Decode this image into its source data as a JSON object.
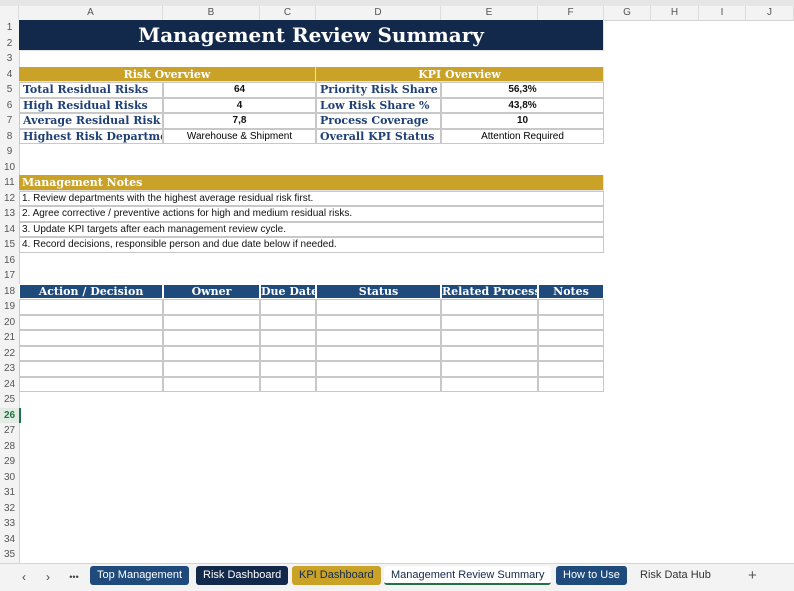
{
  "columns": [
    "A",
    "B",
    "C",
    "D",
    "E",
    "F",
    "G",
    "H",
    "I",
    "J"
  ],
  "rows": [
    "1",
    "2",
    "3",
    "4",
    "5",
    "6",
    "7",
    "8",
    "9",
    "10",
    "11",
    "12",
    "13",
    "14",
    "15",
    "16",
    "17",
    "18",
    "19",
    "20",
    "21",
    "22",
    "23",
    "24",
    "25",
    "26",
    "27",
    "28",
    "29",
    "30",
    "31",
    "32",
    "33",
    "34",
    "35"
  ],
  "title": "Management Review Summary",
  "risk_overview": {
    "header": "Risk Overview",
    "items": [
      {
        "label": "Total Residual Risks",
        "value": "64"
      },
      {
        "label": "High Residual Risks",
        "value": "4"
      },
      {
        "label": "Average Residual Risk",
        "value": "7,8"
      },
      {
        "label": "Highest Risk Department",
        "value": "Warehouse & Shipment"
      }
    ]
  },
  "kpi_overview": {
    "header": "KPI Overview",
    "items": [
      {
        "label": "Priority Risk Share %",
        "value": "56,3%"
      },
      {
        "label": "Low Risk Share %",
        "value": "43,8%"
      },
      {
        "label": "Process Coverage",
        "value": "10"
      },
      {
        "label": "Overall KPI Status",
        "value": "Attention Required"
      }
    ]
  },
  "notes": {
    "header": "Management Notes",
    "items": [
      "1. Review departments with the highest average residual risk first.",
      "2. Agree corrective / preventive actions for high and medium residual risks.",
      "3. Update KPI targets after each management review cycle.",
      "4. Record decisions, responsible person and due date below if needed."
    ]
  },
  "action_table": {
    "headers": [
      "Action / Decision",
      "Owner",
      "Due Date",
      "Status",
      "Related Process",
      "Notes"
    ]
  },
  "tabs": {
    "nav_prev": "‹",
    "nav_next": "›",
    "more": "•••",
    "items": [
      "Top Management",
      "Risk Dashboard",
      "KPI Dashboard",
      "Management Review Summary",
      "How to Use",
      "Risk Data Hub"
    ],
    "add": "+"
  },
  "colors": {
    "navy": "#13294b",
    "gold": "#c9a227",
    "blue": "#1f4b7c",
    "excel_green": "#217346"
  }
}
